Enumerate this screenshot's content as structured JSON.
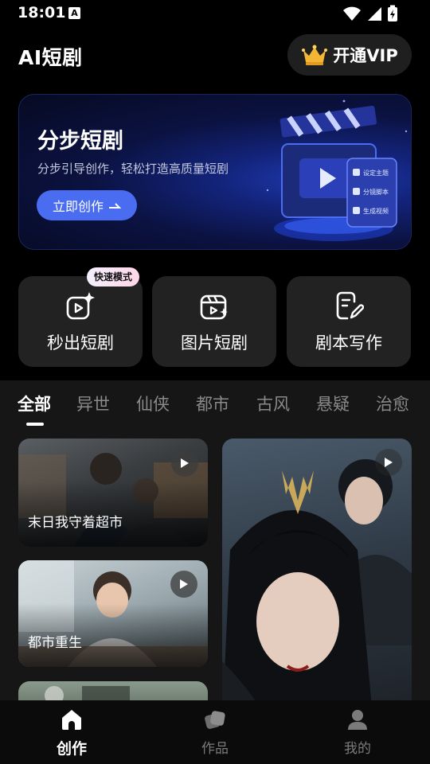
{
  "status": {
    "time": "18:01",
    "notif_letter": "A"
  },
  "header": {
    "title": "AI短剧",
    "vip_label": "开通VIP"
  },
  "banner": {
    "title": "分步短剧",
    "subtitle": "分步引导创作，轻松打造高质量短剧",
    "button_label": "立即创作",
    "panel_items": [
      "设定主题",
      "分镜脚本",
      "生成视频"
    ]
  },
  "quick_actions": [
    {
      "label": "秒出短剧",
      "badge": "快速模式",
      "icon": "video-sparkle-icon"
    },
    {
      "label": "图片短剧",
      "icon": "image-film-icon"
    },
    {
      "label": "剧本写作",
      "icon": "script-edit-icon"
    }
  ],
  "tabs": [
    "全部",
    "异世",
    "仙侠",
    "都市",
    "古风",
    "悬疑",
    "治愈"
  ],
  "active_tab": "全部",
  "feed": [
    {
      "title": "末日我守着超市"
    },
    {
      "title": "都市重生"
    },
    {
      "title": ""
    },
    {
      "title": ""
    }
  ],
  "nav": [
    {
      "label": "创作",
      "icon": "home-icon",
      "active": true
    },
    {
      "label": "作品",
      "icon": "works-icon",
      "active": false
    },
    {
      "label": "我的",
      "icon": "user-icon",
      "active": false
    }
  ],
  "colors": {
    "accent": "#4a6cf0",
    "background": "#000000",
    "card": "#222222",
    "feed_bg": "#161616"
  }
}
